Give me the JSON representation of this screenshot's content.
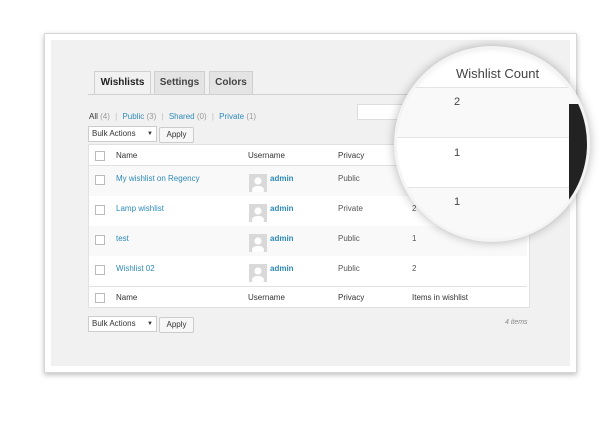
{
  "tabs": [
    {
      "label": "Wishlists",
      "active": true
    },
    {
      "label": "Settings",
      "active": false
    },
    {
      "label": "Colors",
      "active": false
    }
  ],
  "filters": {
    "all": {
      "label": "All",
      "count": "(4)"
    },
    "public": {
      "label": "Public",
      "count": "(3)"
    },
    "shared": {
      "label": "Shared",
      "count": "(0)"
    },
    "private": {
      "label": "Private",
      "count": "(1)"
    },
    "separator": "|"
  },
  "bulk_actions": {
    "label": "Bulk Actions",
    "arrow": "▼"
  },
  "apply_label": "Apply",
  "table": {
    "columns": {
      "name": "Name",
      "username": "Username",
      "privacy": "Privacy",
      "items": "Items in wishlist"
    },
    "rows": [
      {
        "name": "My wishlist on Regency",
        "username": "admin",
        "privacy": "Public",
        "count": "2"
      },
      {
        "name": "Lamp wishlist",
        "username": "admin",
        "privacy": "Private",
        "count": "2"
      },
      {
        "name": "test",
        "username": "admin",
        "privacy": "Public",
        "count": "1"
      },
      {
        "name": "Wishlist 02",
        "username": "admin",
        "privacy": "Public",
        "count": "2"
      }
    ]
  },
  "items_total": "4 items",
  "zoom": {
    "header": "Wishlist Count",
    "values": [
      "2",
      "1",
      "1"
    ]
  },
  "colors": {
    "link": "#2e8ab8",
    "panel": "#f1f1f1"
  }
}
